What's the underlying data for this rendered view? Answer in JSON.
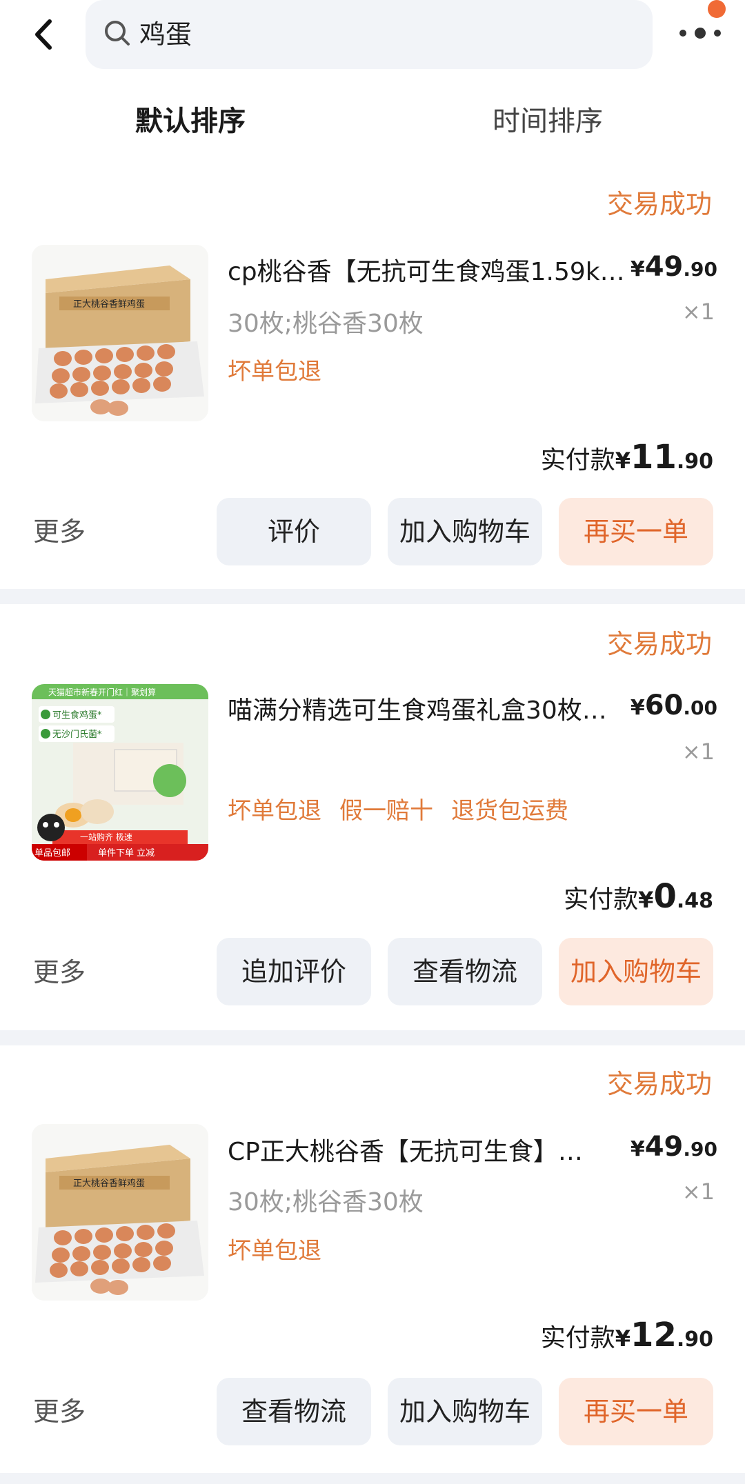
{
  "search": {
    "query": "鸡蛋"
  },
  "sort_tabs": {
    "default": "默认排序",
    "time": "时间排序"
  },
  "orders": [
    {
      "status": "交易成功",
      "title": "cp桃谷香【无抗可生食鸡蛋1.59kg…",
      "spec": "30枚;桃谷香30枚",
      "tags": [
        "坏单包退"
      ],
      "price_int": "49",
      "price_dec": ".90",
      "qty": "×1",
      "paid_label": "实付款",
      "paid_int": "11",
      "paid_dec": ".90",
      "more": "更多",
      "buttons": [
        "评价",
        "加入购物车",
        "再买一单"
      ]
    },
    {
      "status": "交易成功",
      "title": "喵满分精选可生食鸡蛋礼盒30枚…",
      "spec": "",
      "tags": [
        "坏单包退",
        "假一赔十",
        "退货包运费"
      ],
      "price_int": "60",
      "price_dec": ".00",
      "qty": "×1",
      "paid_label": "实付款",
      "paid_int": "0",
      "paid_dec": ".48",
      "more": "更多",
      "buttons": [
        "追加评价",
        "查看物流",
        "加入购物车"
      ]
    },
    {
      "status": "交易成功",
      "title": "CP正大桃谷香【无抗可生食】鲜鸡蛋",
      "spec": "30枚;桃谷香30枚",
      "tags": [
        "坏单包退"
      ],
      "price_int": "49",
      "price_dec": ".90",
      "qty": "×1",
      "paid_label": "实付款",
      "paid_int": "12",
      "paid_dec": ".90",
      "more": "更多",
      "buttons": [
        "查看物流",
        "加入购物车",
        "再买一单"
      ]
    }
  ],
  "product_images": {
    "egg_box_label": "正大桃谷香鲜鸡蛋",
    "banner_top": "天猫超市新春开门红｜聚划算",
    "badge_1": "可生食鸡蛋*",
    "badge_2": "无沙门氏菌*",
    "bottom_left": "单品包邮",
    "bottom_right": "单件下单 立减",
    "bottom_mid": "一站购齐 极速"
  },
  "colors": {
    "accent": "#e07a3a",
    "primary_btn_bg": "#fde9df",
    "btn_bg": "#eef1f6",
    "search_bg": "#f2f4f8"
  }
}
